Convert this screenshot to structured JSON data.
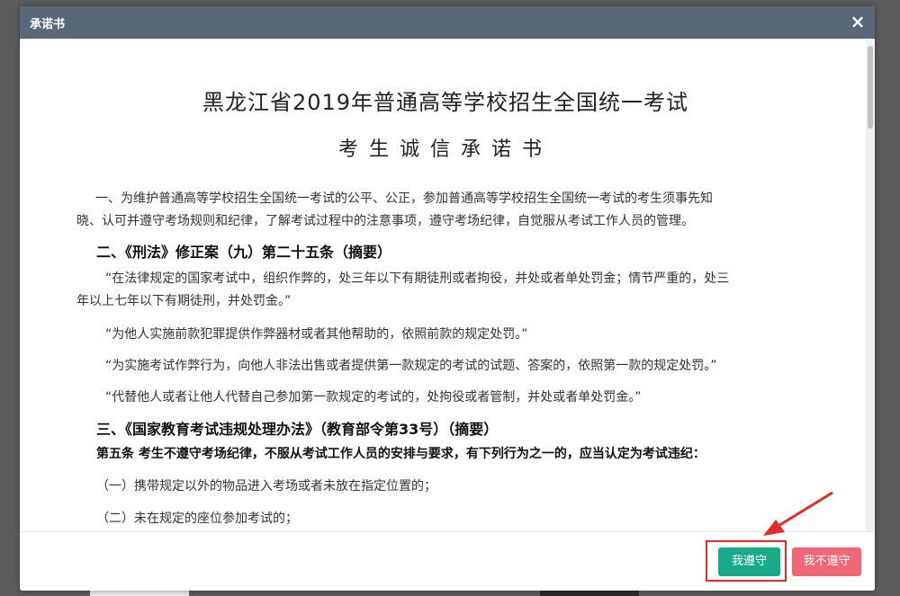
{
  "modal": {
    "title": "承诺书",
    "close_icon": "×"
  },
  "document": {
    "title": "黑龙江省2019年普通高等学校招生全国统一考试",
    "subtitle": "考生诚信承诺书",
    "intro_line1": "一、为维护普通高等学校招生全国统一考试的公平、公正，参加普通高等学校招生全国统一考试的考生须事先知",
    "intro_line2": "晓、认可并遵守考场规则和纪律，了解考试过程中的注意事项，遵守考场纪律，自觉服从考试工作人员的管理。",
    "section2_heading": "二、《刑法》修正案（九）第二十五条（摘要）",
    "quote1_line1": "“在法律规定的国家考试中，组织作弊的，处三年以下有期徒刑或者拘役，并处或者单处罚金；情节严重的，处三",
    "quote1_line2": "年以上七年以下有期徒刑，并处罚金。”",
    "quote2": "“为他人实施前款犯罪提供作弊器材或者其他帮助的，依照前款的规定处罚。”",
    "quote3": "“为实施考试作弊行为，向他人非法出售或者提供第一款规定的考试的试题、答案的，依照第一款的规定处罚。”",
    "quote4": "“代替他人或者让他人代替自己参加第一款规定的考试的，处拘役或者管制，并处或者单处罚金。”",
    "section3_heading": "三、《国家教育考试违规处理办法》（教育部令第33号）（摘要）",
    "article5": "第五条 考生不遵守考场纪律，不服从考试工作人员的安排与要求，有下列行为之一的，应当认定为考试违纪：",
    "item1": "（一）携带规定以外的物品进入考场或者未放在指定位置的；",
    "item2": "（二）未在规定的座位参加考试的；"
  },
  "footer": {
    "agree_label": "我遵守",
    "disagree_label": "我不遵守"
  },
  "colors": {
    "header_bg": "#5a6779",
    "agree": "#1aaa8a",
    "disagree": "#f06873",
    "annotation": "#e52a2a"
  }
}
